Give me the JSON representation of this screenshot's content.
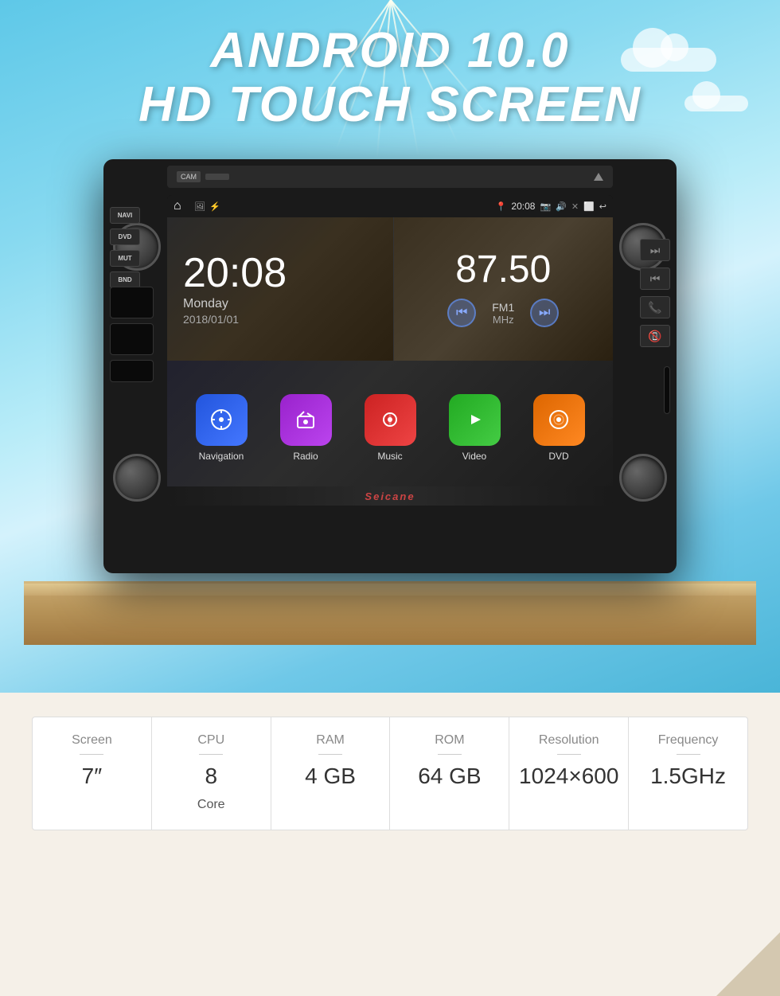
{
  "header": {
    "line1": "ANDROID 10.0",
    "line2": "HD TOUCH SCREEN"
  },
  "unit": {
    "top_bar": {
      "cam_label": "CAM"
    },
    "left_buttons": [
      {
        "label": "NAVI"
      },
      {
        "label": "DVD"
      },
      {
        "label": "MUT"
      },
      {
        "label": "BND"
      }
    ]
  },
  "screen": {
    "status_bar": {
      "time": "20:08"
    },
    "clock": {
      "time": "20:08",
      "day": "Monday",
      "date": "2018/01/01"
    },
    "radio": {
      "frequency": "87.50",
      "band": "FM1",
      "unit": "MHz"
    },
    "apps": [
      {
        "label": "Navigation",
        "color": "nav"
      },
      {
        "label": "Radio",
        "color": "radio"
      },
      {
        "label": "Music",
        "color": "music"
      },
      {
        "label": "Video",
        "color": "video"
      },
      {
        "label": "DVD",
        "color": "dvd"
      }
    ],
    "watermark": "Seicane"
  },
  "specs": [
    {
      "label": "Screen",
      "value": "7″",
      "unit": ""
    },
    {
      "label": "CPU",
      "value": "8",
      "unit": "Core"
    },
    {
      "label": "RAM",
      "value": "4 GB",
      "unit": ""
    },
    {
      "label": "ROM",
      "value": "64 GB",
      "unit": ""
    },
    {
      "label": "Resolution",
      "value": "1024×600",
      "unit": ""
    },
    {
      "label": "Frequency",
      "value": "1.5GHz",
      "unit": ""
    }
  ]
}
